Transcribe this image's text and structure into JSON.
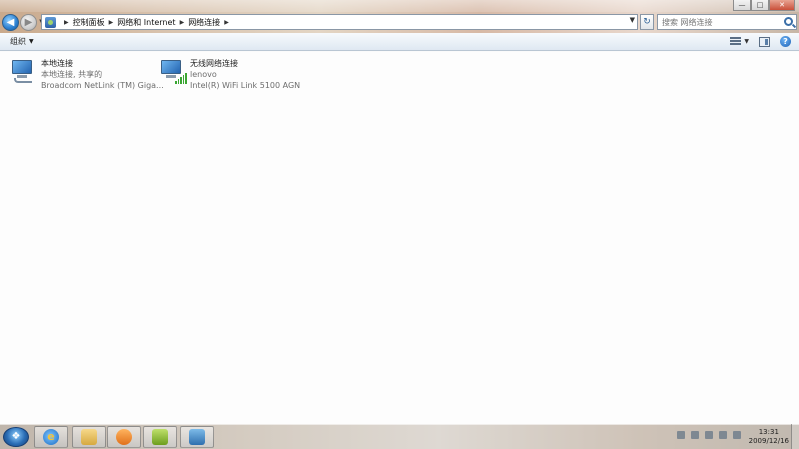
{
  "breadcrumb": [
    "控制面板",
    "网络和 Internet",
    "网络连接"
  ],
  "search": {
    "placeholder": "搜索 网络连接"
  },
  "toolbar": {
    "organize_label": "组织"
  },
  "connections": [
    {
      "name": "本地连接",
      "status": "本地连接, 共享的",
      "device": "Broadcom NetLink (TM) Giga...",
      "icon": "ethernet-connection-icon"
    },
    {
      "name": "无线网络连接",
      "status": "lenovo",
      "device": "Intel(R) WiFi Link 5100 AGN",
      "icon": "wireless-connection-icon"
    }
  ],
  "taskbar": {
    "time": "13:31",
    "date": "2009/12/16",
    "pinned": [
      "internet-explorer-icon",
      "folder-icon",
      "media-player-icon",
      "download-icon",
      "network-control-panel-icon"
    ]
  }
}
